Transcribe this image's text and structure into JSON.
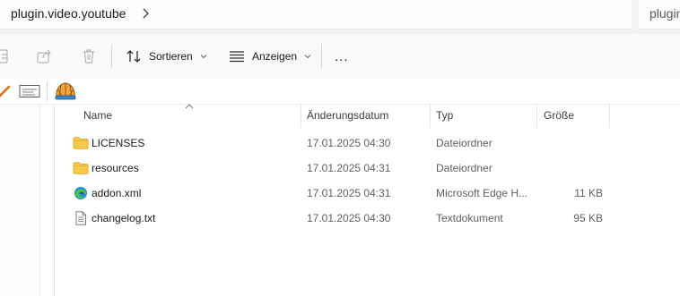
{
  "address_bar": {
    "path": "plugin.video.youtube",
    "search_placeholder": "plugin"
  },
  "command_bar": {
    "sort_label": "Sortieren",
    "view_label": "Anzeigen",
    "more_label": "..."
  },
  "columns": {
    "name": "Name",
    "date": "Änderungsdatum",
    "type": "Typ",
    "size": "Größe"
  },
  "files": [
    {
      "name": "LICENSES",
      "date": "17.01.2025 04:30",
      "type": "Dateiordner",
      "size": "",
      "icon": "folder-icon"
    },
    {
      "name": "resources",
      "date": "17.01.2025 04:31",
      "type": "Dateiordner",
      "size": "",
      "icon": "folder-icon"
    },
    {
      "name": "addon.xml",
      "date": "17.01.2025 04:31",
      "type": "Microsoft Edge H...",
      "size": "11 KB",
      "icon": "edge-icon"
    },
    {
      "name": "changelog.txt",
      "date": "17.01.2025 04:30",
      "type": "Textdokument",
      "size": "95 KB",
      "icon": "text-file-icon"
    }
  ],
  "colors": {
    "folder": "#f6c94a",
    "edge_blue": "#1b8fd8",
    "edge_green": "#4fc24a",
    "accent_orange": "#e8701a"
  }
}
